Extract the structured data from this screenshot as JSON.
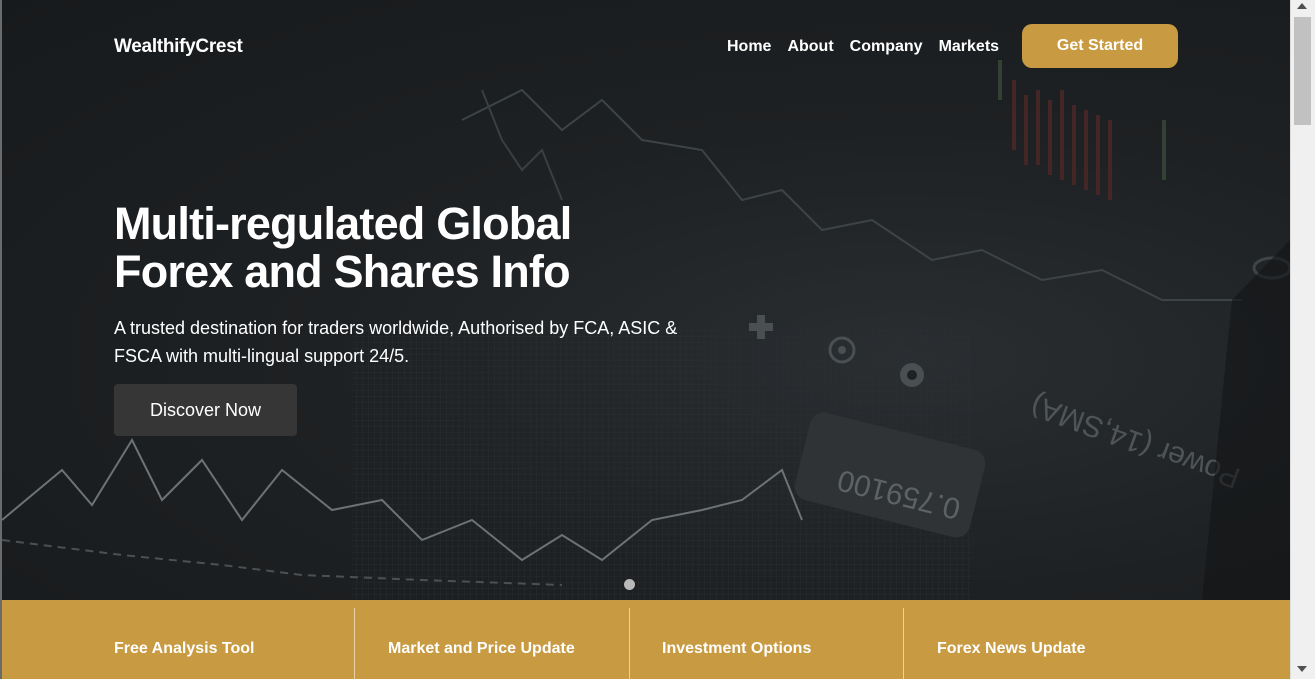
{
  "header": {
    "brand": "WealthifyCrest",
    "nav": [
      "Home",
      "About",
      "Company",
      "Markets"
    ],
    "cta_label": "Get Started"
  },
  "hero": {
    "title": "Multi-regulated Global Forex and Shares Info",
    "subtitle": "A trusted destination for traders worldwide, Authorised by FCA, ASIC & FSCA with multi-lingual support 24/5.",
    "button_label": "Discover Now",
    "background_text": [
      "Power (14,SMA)",
      "0.759100"
    ]
  },
  "features": [
    "Free Analysis Tool",
    "Market and Price Update",
    "Investment Options",
    "Forex News Update"
  ],
  "colors": {
    "accent": "#c89b42",
    "dark_button": "#363636",
    "hero_bg": "#1e2123"
  }
}
